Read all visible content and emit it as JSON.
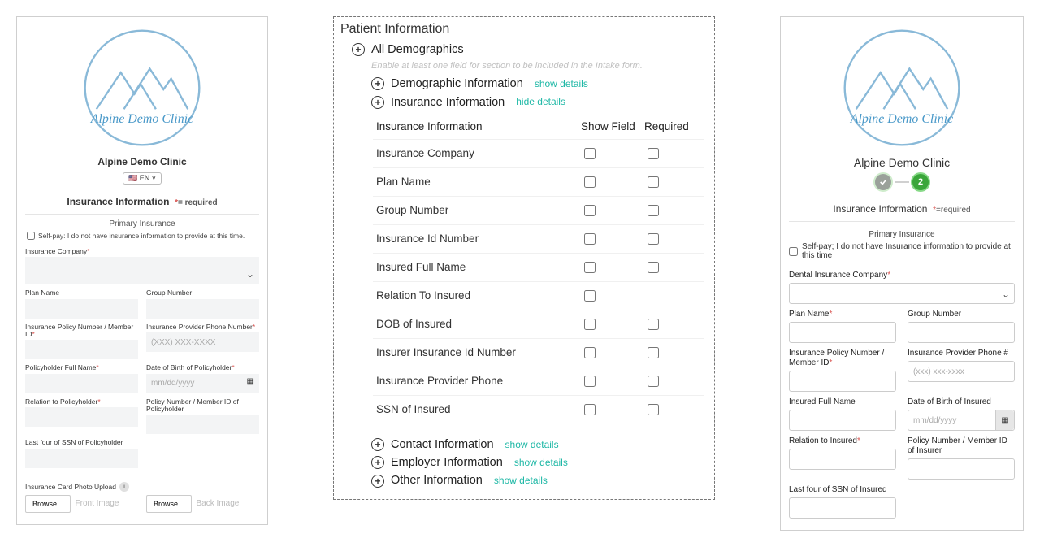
{
  "left": {
    "clinic_name": "Alpine Demo Clinic",
    "lang_label": "EN",
    "section_title": "Insurance Information",
    "required_note": "= required",
    "primary_title": "Primary Insurance",
    "selfpay_text": "Self-pay: I do not have insurance information to provide at this time.",
    "insurance_company_label": "Insurance Company",
    "plan_name_label": "Plan Name",
    "group_number_label": "Group Number",
    "policy_number_label": "Insurance Policy Number / Member ID",
    "provider_phone_label": "Insurance Provider Phone Number",
    "provider_phone_placeholder": "(XXX) XXX-XXXX",
    "policyholder_name_label": "Policyholder Full Name",
    "dob_label": "Date of Birth of Policyholder",
    "dob_placeholder": "mm/dd/yyyy",
    "relation_label": "Relation to Policyholder",
    "member_id_label": "Policy Number / Member ID of Policyholder",
    "ssn_label": "Last four of SSN of Policyholder",
    "upload_label": "Insurance Card Photo Upload",
    "browse_label": "Browse...",
    "front_image": "Front Image",
    "back_image": "Back Image"
  },
  "mid": {
    "title": "Patient Information",
    "all_demographics": "All Demographics",
    "hint": "Enable at least one field for section to be included in the Intake form.",
    "demographic_info": "Demographic Information",
    "insurance_info": "Insurance Information",
    "show_details": "show details",
    "hide_details": "hide details",
    "table_header_name": "Insurance Information",
    "table_header_show": "Show Field",
    "table_header_required": "Required",
    "rows": [
      {
        "name": "Insurance Company",
        "show": true,
        "req": true
      },
      {
        "name": "Plan Name",
        "show": true,
        "req": true
      },
      {
        "name": "Group Number",
        "show": true,
        "req": true
      },
      {
        "name": "Insurance Id Number",
        "show": true,
        "req": true
      },
      {
        "name": "Insured Full Name",
        "show": true,
        "req": true
      },
      {
        "name": "Relation To Insured",
        "show": true,
        "req": false
      },
      {
        "name": "DOB of Insured",
        "show": true,
        "req": true
      },
      {
        "name": "Insurer Insurance Id Number",
        "show": true,
        "req": true
      },
      {
        "name": "Insurance Provider Phone",
        "show": true,
        "req": true
      },
      {
        "name": "SSN of Insured",
        "show": true,
        "req": true
      }
    ],
    "contact_info": "Contact Information",
    "employer_info": "Employer Information",
    "other_info": "Other Information"
  },
  "right": {
    "clinic_name": "Alpine Demo Clinic",
    "step2": "2",
    "section_title": "Insurance Information",
    "required_note": "=required",
    "primary_title": "Primary Insurance",
    "selfpay_text": "Self-pay; I do not have Insurance information to provide at this time",
    "company_label": "Dental Insurance Company",
    "plan_name_label": "Plan Name",
    "group_number_label": "Group Number",
    "policy_number_label": "Insurance Policy Number / Member ID",
    "provider_phone_label": "Insurance Provider Phone #",
    "provider_phone_placeholder": "(xxx) xxx-xxxx",
    "insured_name_label": "Insured Full Name",
    "dob_label": "Date of Birth of Insured",
    "dob_placeholder": "mm/dd/yyyy",
    "relation_label": "Relation to Insured",
    "member_id_label": "Policy Number / Member ID of Insurer",
    "ssn_label": "Last four of SSN of Insured"
  }
}
